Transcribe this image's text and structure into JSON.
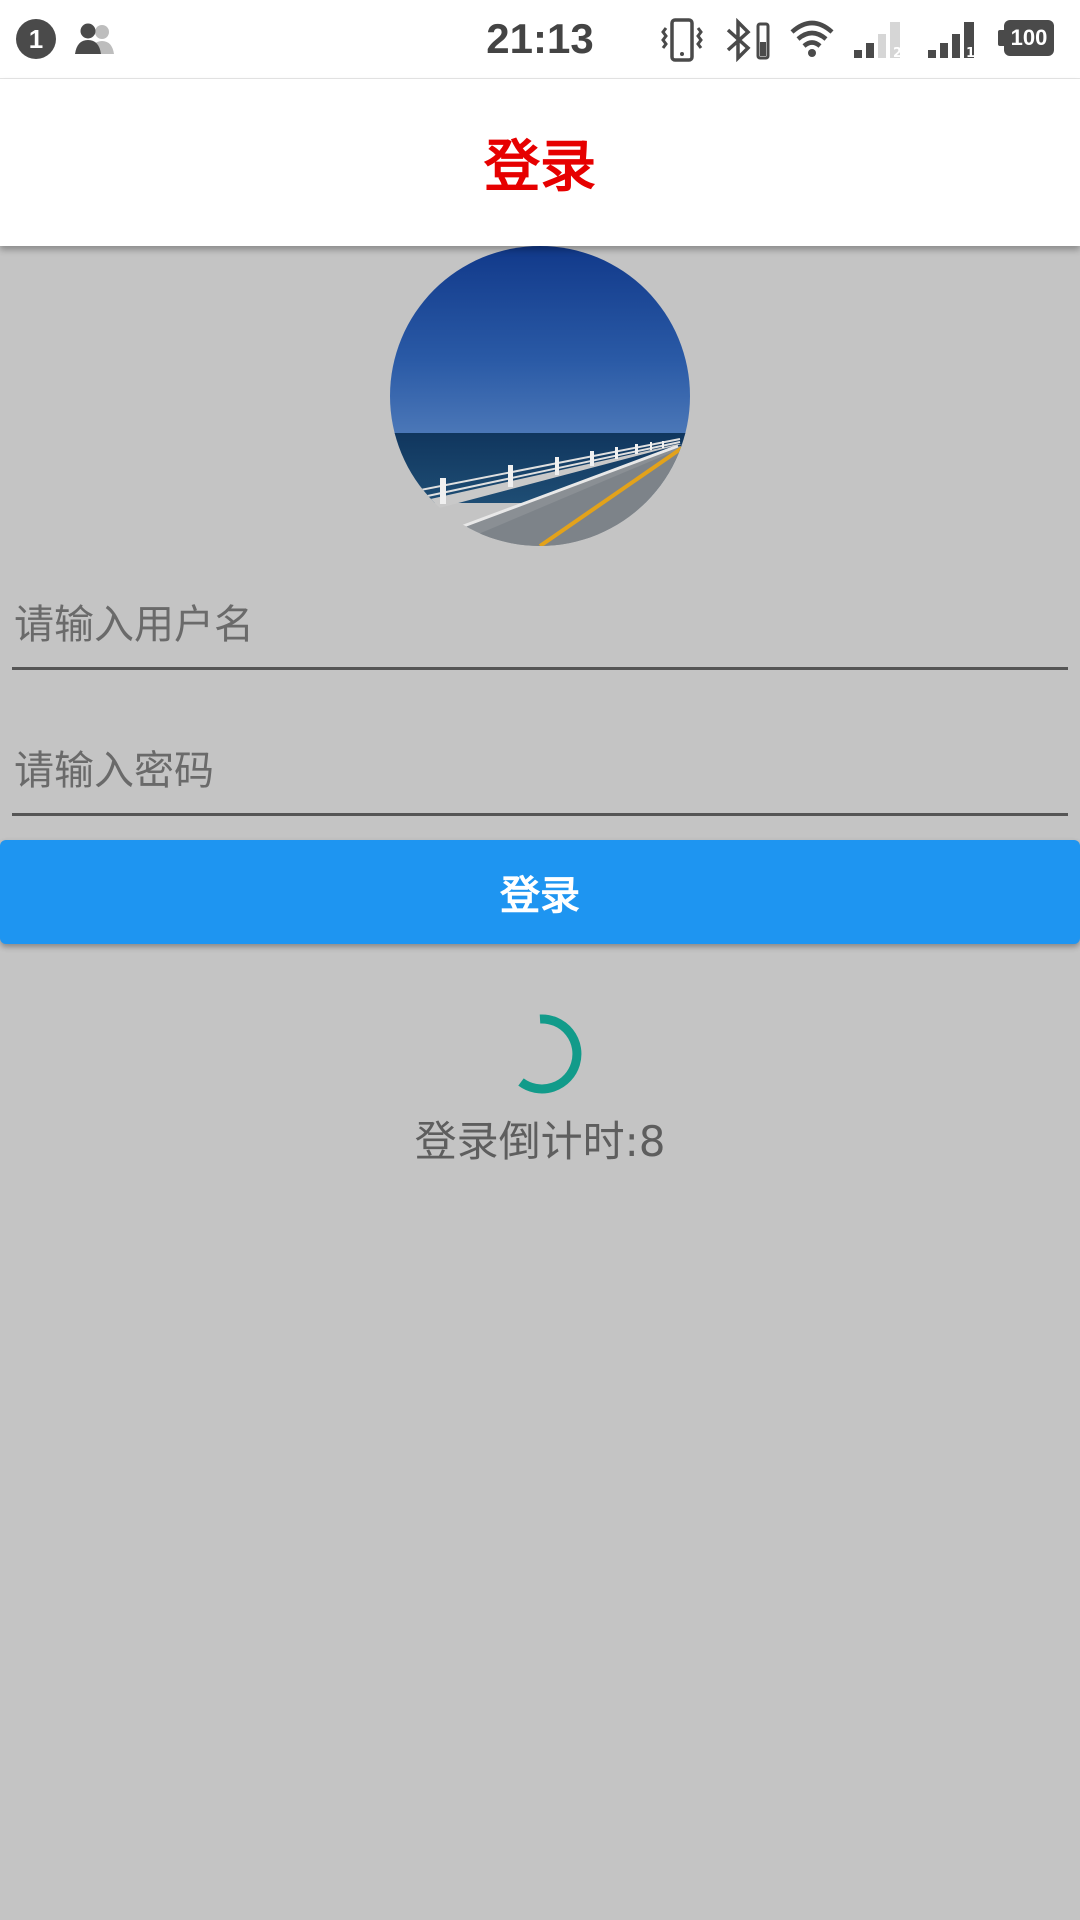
{
  "status_bar": {
    "notification_count": "1",
    "time": "21:13",
    "battery_level": "100",
    "icons": [
      "users-icon",
      "vibrate-icon",
      "bluetooth-icon",
      "wifi-icon",
      "signal-sim2-icon",
      "signal-sim1-icon",
      "battery-icon"
    ]
  },
  "app_bar": {
    "title": "登录",
    "title_color": "#e60000"
  },
  "avatar": {
    "description_icon": "avatar-seaside-road"
  },
  "form": {
    "username": {
      "placeholder": "请输入用户名",
      "value": ""
    },
    "password": {
      "placeholder": "请输入密码",
      "value": ""
    },
    "login_label": "登录",
    "button_color": "#1e95f1"
  },
  "loading": {
    "countdown_text": "登录倒计时:8",
    "spinner_color": "#129b8a"
  },
  "colors": {
    "background": "#c4c4c4"
  }
}
